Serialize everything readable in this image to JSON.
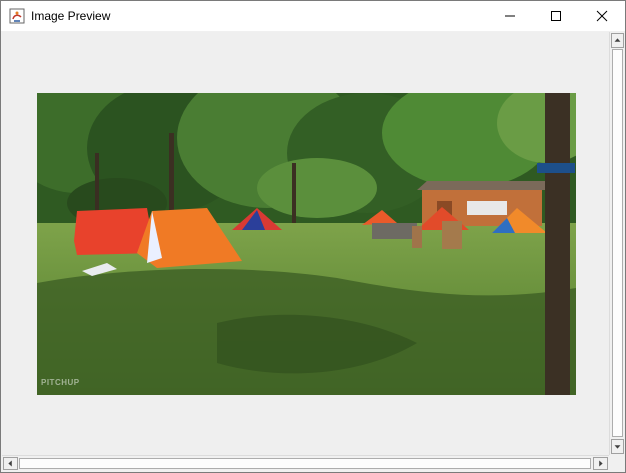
{
  "window": {
    "title": "Image Preview",
    "icon": "java-app-icon",
    "controls": [
      "minimize-icon",
      "maximize-icon",
      "close-icon"
    ]
  },
  "image": {
    "subject": "",
    "watermark": "PITCHUP"
  },
  "scrollbars": {
    "vertical": "up-arrow/down-arrow",
    "horizontal": "left-arrow/right-arrow"
  },
  "colors": {
    "window_bg": "#f0f0f0",
    "titlebar_bg": "#ffffff"
  }
}
